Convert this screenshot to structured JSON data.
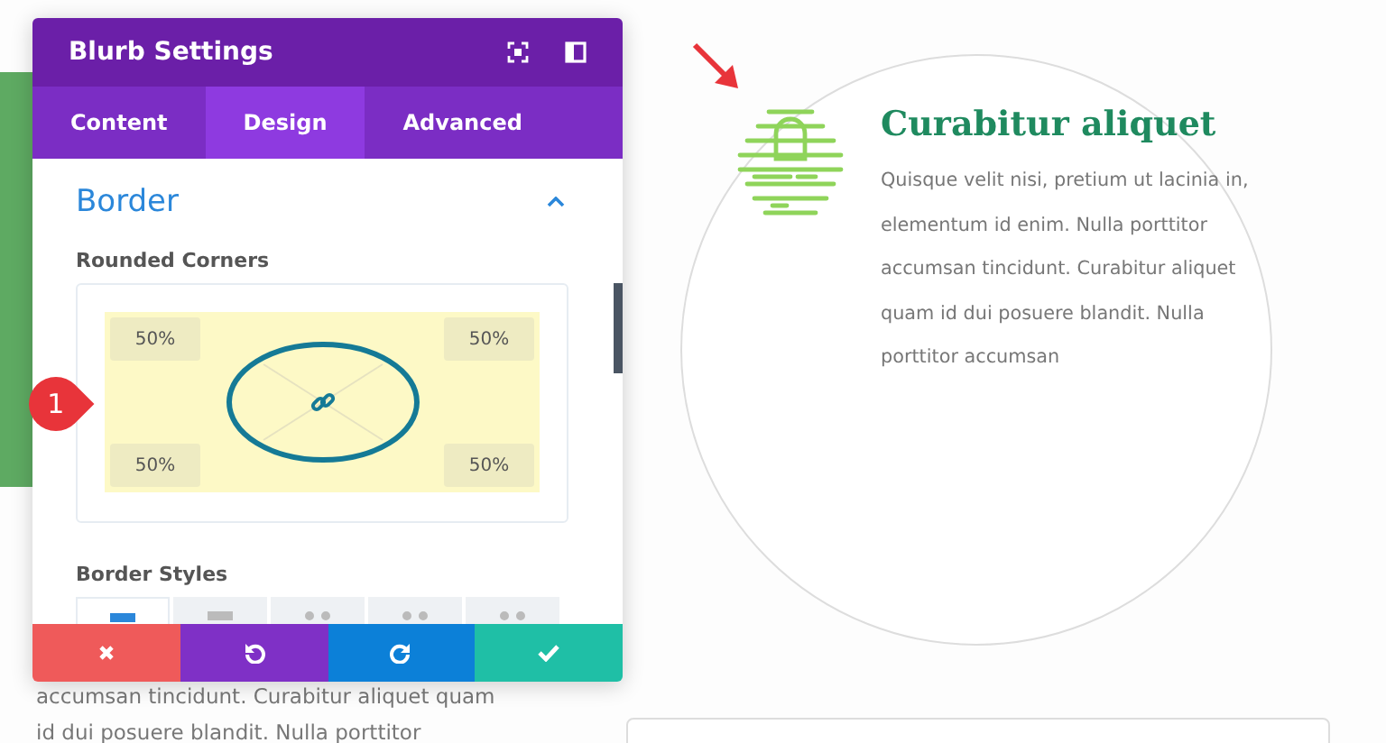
{
  "panel": {
    "title": "Blurb Settings",
    "tabs": [
      {
        "label": "Content",
        "selected": false
      },
      {
        "label": "Design",
        "selected": true
      },
      {
        "label": "Advanced",
        "selected": false
      }
    ],
    "section": {
      "title": "Border",
      "expanded": true
    },
    "rounded_corners": {
      "label": "Rounded Corners",
      "values": [
        "50%",
        "50%",
        "50%",
        "50%"
      ],
      "linked": true
    },
    "border_styles": {
      "label": "Border Styles",
      "options": [
        {
          "kind": "solid",
          "selected": true
        },
        {
          "kind": "dashed",
          "selected": false
        },
        {
          "kind": "dotted",
          "selected": false
        },
        {
          "kind": "dotted",
          "selected": false
        },
        {
          "kind": "dotted",
          "selected": false
        }
      ]
    },
    "actions": [
      {
        "kind": "cancel"
      },
      {
        "kind": "undo"
      },
      {
        "kind": "redo"
      },
      {
        "kind": "save"
      }
    ]
  },
  "step_badge": "1",
  "blurb": {
    "title": "Curabitur aliquet",
    "body": "Quisque velit nisi, pretium ut lacinia in, elementum id enim. Nulla porttitor accumsan tincidunt. Curabitur aliquet quam id dui posuere blandit. Nulla porttitor accumsan"
  },
  "background_text": [
    "accumsan tincidunt. Curabitur aliquet quam",
    "id dui posuere blandit. Nulla porttitor"
  ]
}
